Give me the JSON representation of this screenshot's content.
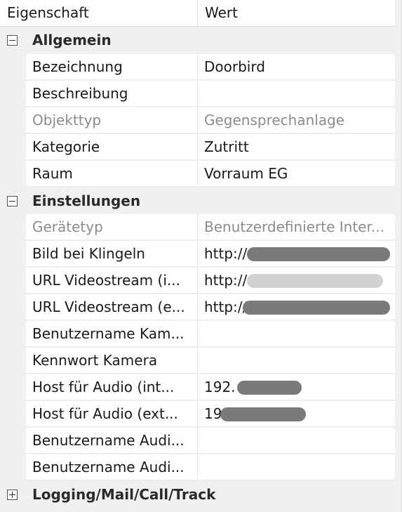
{
  "header": {
    "property_col": "Eigenschaft",
    "value_col": "Wert"
  },
  "categories": [
    {
      "label": "Allgemein",
      "expanded": true,
      "rows": [
        {
          "name": "Bezeichnung",
          "value": "Doorbird",
          "readonly": false
        },
        {
          "name": "Beschreibung",
          "value": "",
          "readonly": false
        },
        {
          "name": "Objekttyp",
          "value": "Gegensprechanlage",
          "readonly": true
        },
        {
          "name": "Kategorie",
          "value": "Zutritt",
          "readonly": false
        },
        {
          "name": "Raum",
          "value": "Vorraum EG",
          "readonly": false
        }
      ]
    },
    {
      "label": "Einstellungen",
      "expanded": true,
      "rows": [
        {
          "name": "Gerätetyp",
          "value": "Benutzerdefinierte Inter...",
          "readonly": true
        },
        {
          "name": "Bild bei Klingeln",
          "value": "http://",
          "readonly": false,
          "redacted": true
        },
        {
          "name": "URL Videostream (i...",
          "value": "http://",
          "readonly": false,
          "redacted": true
        },
        {
          "name": "URL Videostream (e...",
          "value": "http://",
          "readonly": false,
          "redacted": true
        },
        {
          "name": "Benutzername Kam...",
          "value": "",
          "readonly": false
        },
        {
          "name": "Kennwort Kamera",
          "value": "",
          "readonly": false
        },
        {
          "name": "Host für Audio (int...",
          "value": "192.",
          "readonly": false,
          "redacted": true
        },
        {
          "name": "Host für Audio (ext...",
          "value": "192.",
          "readonly": false,
          "redacted": true
        },
        {
          "name": "Benutzername Audi...",
          "value": "",
          "readonly": false
        },
        {
          "name": "Benutzername Audi...",
          "value": "",
          "readonly": false
        }
      ]
    },
    {
      "label": "Logging/Mail/Call/Track",
      "expanded": false,
      "rows": []
    }
  ],
  "icons": {
    "expanded": "minus-box-icon",
    "collapsed": "plus-box-icon"
  }
}
